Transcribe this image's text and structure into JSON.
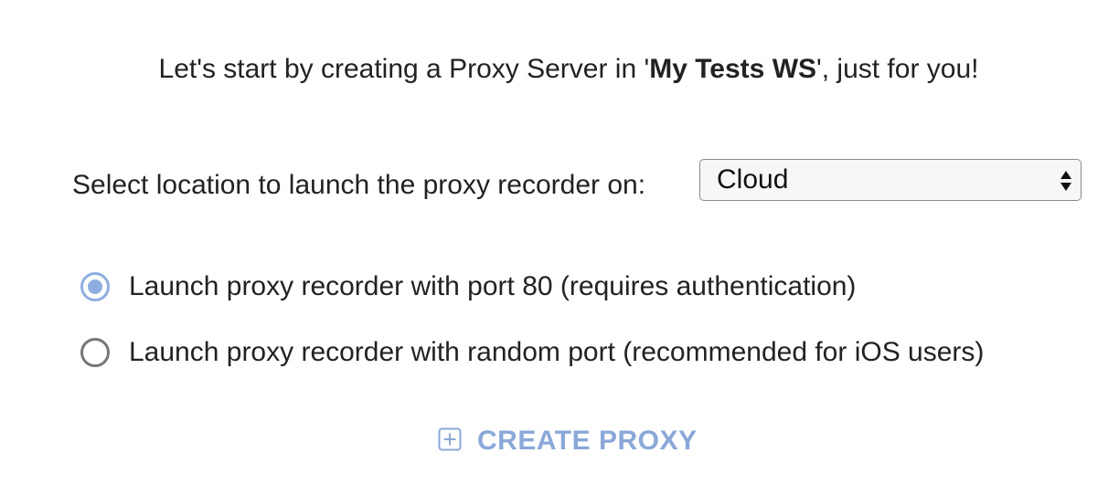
{
  "intro": {
    "prefix": "Let's start by creating a Proxy Server in '",
    "workspace": "My Tests WS",
    "suffix": "', just for you!"
  },
  "location": {
    "label": "Select location to launch the proxy recorder on:",
    "selected": "Cloud"
  },
  "options": [
    {
      "label": "Launch proxy recorder with port 80 (requires authentication)",
      "checked": true
    },
    {
      "label": "Launch proxy recorder with random port (recommended for iOS users)",
      "checked": false
    }
  ],
  "actions": {
    "create_label": "CREATE PROXY",
    "create_icon": "plus-square-icon"
  },
  "colors": {
    "accent": "#8aa8d8",
    "radio_checked": "#8eaee0",
    "text": "#222222"
  }
}
